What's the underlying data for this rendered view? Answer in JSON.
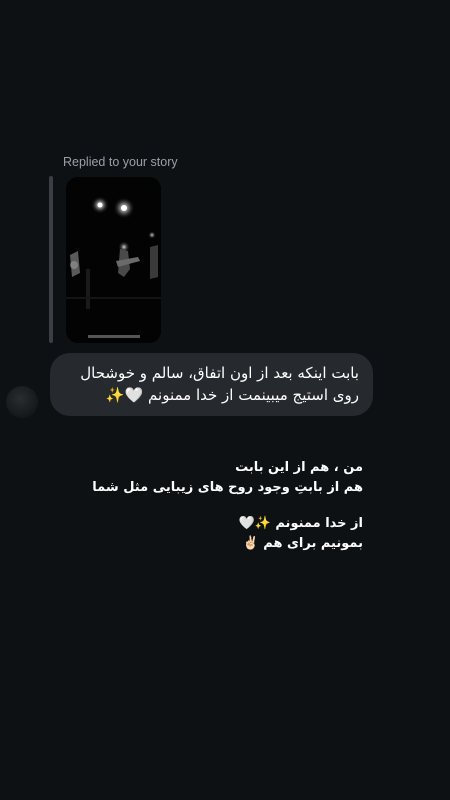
{
  "reply": {
    "label": "Replied to your story"
  },
  "message": {
    "line1": "بابت اینکه بعد از اون اتفاق، سالم و خوشحال",
    "line2": "روی استیج میبینمت از خدا ممنونم 🤍✨"
  },
  "caption": {
    "line1": "من ، هم از این بابت",
    "line2": "هم از بابتِ وجود روح های زیبایی مثل شما",
    "line3": "از خدا ممنونم ✨🤍",
    "line4": "بمونیم برای هم ✌🏻"
  },
  "colors": {
    "background": "#0d1114",
    "bubble": "#262a2e",
    "label": "#9aa0a6"
  }
}
